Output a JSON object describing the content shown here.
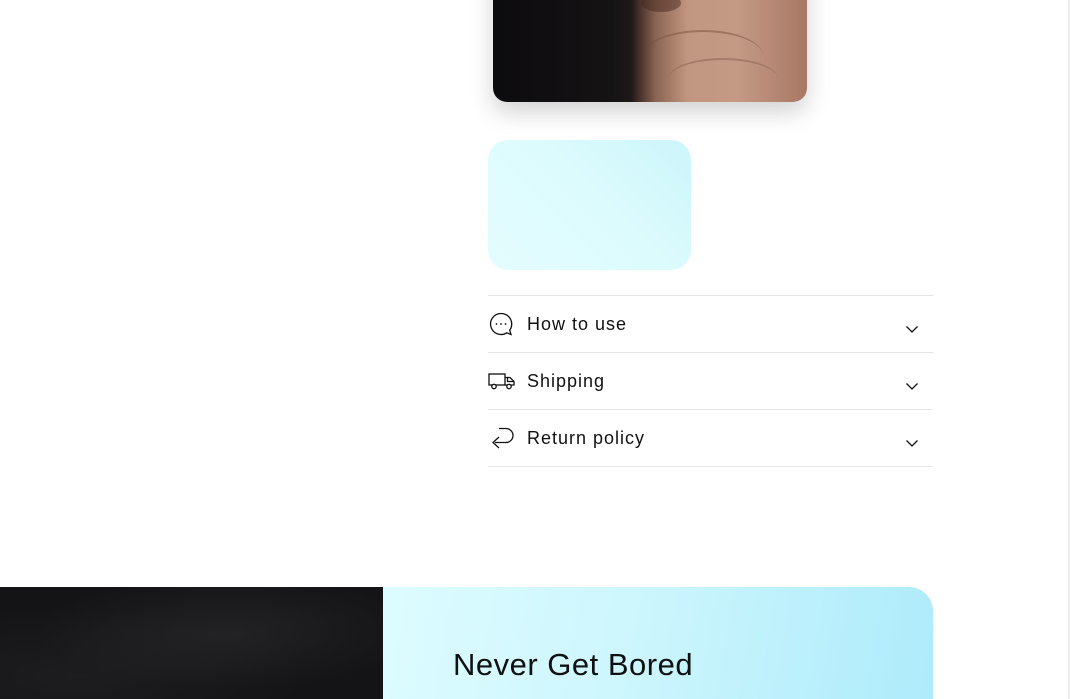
{
  "accordion": {
    "items": [
      {
        "label": "How to use",
        "icon": "chat-bubble-icon"
      },
      {
        "label": "Shipping",
        "icon": "truck-icon"
      },
      {
        "label": "Return policy",
        "icon": "return-arrow-icon"
      }
    ]
  },
  "banner": {
    "title": "Never Get Bored"
  },
  "colors": {
    "swatch": "#dcfbfd",
    "banner_panel": "#cdf6fd",
    "text": "#111111",
    "divider": "#e4e4e4"
  }
}
